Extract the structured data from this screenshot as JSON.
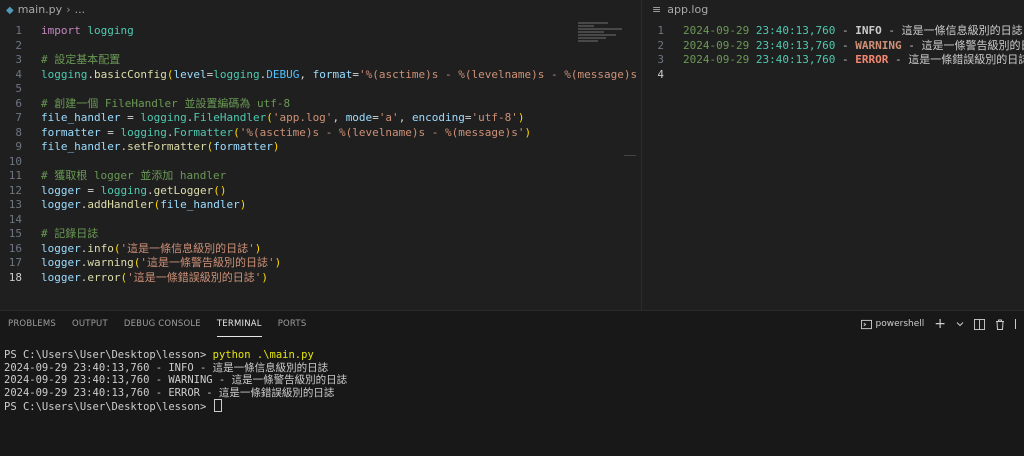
{
  "left_tab": {
    "filename": "main.py",
    "crumb_rest": "..."
  },
  "code_lines": [
    {
      "n": "1",
      "segs": [
        [
          "kw",
          "import"
        ],
        [
          "pl",
          " "
        ],
        [
          "cls",
          "logging"
        ]
      ]
    },
    {
      "n": "2",
      "segs": []
    },
    {
      "n": "3",
      "segs": [
        [
          "cm",
          "# 設定基本配置"
        ]
      ]
    },
    {
      "n": "4",
      "segs": [
        [
          "cls",
          "logging"
        ],
        [
          "pl",
          "."
        ],
        [
          "fn",
          "basicConfig"
        ],
        [
          "br1",
          "("
        ],
        [
          "var",
          "level"
        ],
        [
          "op",
          "="
        ],
        [
          "cls",
          "logging"
        ],
        [
          "pl",
          "."
        ],
        [
          "const",
          "DEBUG"
        ],
        [
          "pl",
          ", "
        ],
        [
          "var",
          "format"
        ],
        [
          "op",
          "="
        ],
        [
          "str",
          "'%(asctime)s - %(levelname)s - %(message)s'"
        ],
        [
          "br1",
          ")"
        ]
      ]
    },
    {
      "n": "5",
      "segs": []
    },
    {
      "n": "6",
      "segs": [
        [
          "cm",
          "# 創建一個 FileHandler 並設置編碼為 utf-8"
        ]
      ]
    },
    {
      "n": "7",
      "segs": [
        [
          "var",
          "file_handler"
        ],
        [
          "op",
          " = "
        ],
        [
          "cls",
          "logging"
        ],
        [
          "pl",
          "."
        ],
        [
          "cls",
          "FileHandler"
        ],
        [
          "br1",
          "("
        ],
        [
          "str",
          "'app.log'"
        ],
        [
          "pl",
          ", "
        ],
        [
          "var",
          "mode"
        ],
        [
          "op",
          "="
        ],
        [
          "str",
          "'a'"
        ],
        [
          "pl",
          ", "
        ],
        [
          "var",
          "encoding"
        ],
        [
          "op",
          "="
        ],
        [
          "str",
          "'utf-8'"
        ],
        [
          "br1",
          ")"
        ]
      ]
    },
    {
      "n": "8",
      "segs": [
        [
          "var",
          "formatter"
        ],
        [
          "op",
          " = "
        ],
        [
          "cls",
          "logging"
        ],
        [
          "pl",
          "."
        ],
        [
          "cls",
          "Formatter"
        ],
        [
          "br1",
          "("
        ],
        [
          "str",
          "'%(asctime)s - %(levelname)s - %(message)s'"
        ],
        [
          "br1",
          ")"
        ]
      ]
    },
    {
      "n": "9",
      "segs": [
        [
          "var",
          "file_handler"
        ],
        [
          "pl",
          "."
        ],
        [
          "fn",
          "setFormatter"
        ],
        [
          "br1",
          "("
        ],
        [
          "var",
          "formatter"
        ],
        [
          "br1",
          ")"
        ]
      ]
    },
    {
      "n": "10",
      "segs": []
    },
    {
      "n": "11",
      "segs": [
        [
          "cm",
          "# 獲取根 logger 並添加 handler"
        ]
      ]
    },
    {
      "n": "12",
      "segs": [
        [
          "var",
          "logger"
        ],
        [
          "op",
          " = "
        ],
        [
          "cls",
          "logging"
        ],
        [
          "pl",
          "."
        ],
        [
          "fn",
          "getLogger"
        ],
        [
          "br1",
          "()"
        ]
      ]
    },
    {
      "n": "13",
      "segs": [
        [
          "var",
          "logger"
        ],
        [
          "pl",
          "."
        ],
        [
          "fn",
          "addHandler"
        ],
        [
          "br1",
          "("
        ],
        [
          "var",
          "file_handler"
        ],
        [
          "br1",
          ")"
        ]
      ]
    },
    {
      "n": "14",
      "segs": []
    },
    {
      "n": "15",
      "segs": [
        [
          "cm",
          "# 記錄日誌"
        ]
      ]
    },
    {
      "n": "16",
      "segs": [
        [
          "var",
          "logger"
        ],
        [
          "pl",
          "."
        ],
        [
          "fn",
          "info"
        ],
        [
          "br1",
          "("
        ],
        [
          "str",
          "'這是一條信息級別的日誌'"
        ],
        [
          "br1",
          ")"
        ]
      ]
    },
    {
      "n": "17",
      "segs": [
        [
          "var",
          "logger"
        ],
        [
          "pl",
          "."
        ],
        [
          "fn",
          "warning"
        ],
        [
          "br1",
          "("
        ],
        [
          "str",
          "'這是一條警告級別的日誌'"
        ],
        [
          "br1",
          ")"
        ]
      ]
    },
    {
      "n": "18",
      "segs": [
        [
          "var",
          "logger"
        ],
        [
          "pl",
          "."
        ],
        [
          "fn",
          "error"
        ],
        [
          "br1",
          "("
        ],
        [
          "str",
          "'這是一條錯誤級別的日誌'"
        ],
        [
          "br1",
          ")"
        ]
      ],
      "current": true
    }
  ],
  "right_tab": {
    "filename": "app.log"
  },
  "log_lines": [
    {
      "n": "1",
      "date": "2024-09-29",
      "time": "23:40:13,760",
      "level": "INFO",
      "level_class": "log-info",
      "msg": "這是一條信息級別的日誌"
    },
    {
      "n": "2",
      "date": "2024-09-29",
      "time": "23:40:13,760",
      "level": "WARNING",
      "level_class": "log-warn",
      "msg": "這是一條警告級別的日誌"
    },
    {
      "n": "3",
      "date": "2024-09-29",
      "time": "23:40:13,760",
      "level": "ERROR",
      "level_class": "log-err",
      "msg": "這是一條錯誤級別的日誌"
    },
    {
      "n": "4",
      "empty": true
    }
  ],
  "panel": {
    "tabs": [
      "PROBLEMS",
      "OUTPUT",
      "DEBUG CONSOLE",
      "TERMINAL",
      "PORTS"
    ],
    "active_tab": "TERMINAL",
    "shell_name": "powershell",
    "add_icon": "+",
    "chevron_icon": "chevron-down-icon",
    "split_icon": "split-icon",
    "trash_icon": "trash-icon"
  },
  "terminal": {
    "prompt1": "PS C:\\Users\\User\\Desktop\\lesson> ",
    "command": "python .\\main.py",
    "output": [
      "2024-09-29 23:40:13,760 - INFO - 這是一條信息級別的日誌",
      "2024-09-29 23:40:13,760 - WARNING - 這是一條警告級別的日誌",
      "2024-09-29 23:40:13,760 - ERROR - 這是一條錯誤級別的日誌"
    ],
    "prompt2": "PS C:\\Users\\User\\Desktop\\lesson> "
  }
}
